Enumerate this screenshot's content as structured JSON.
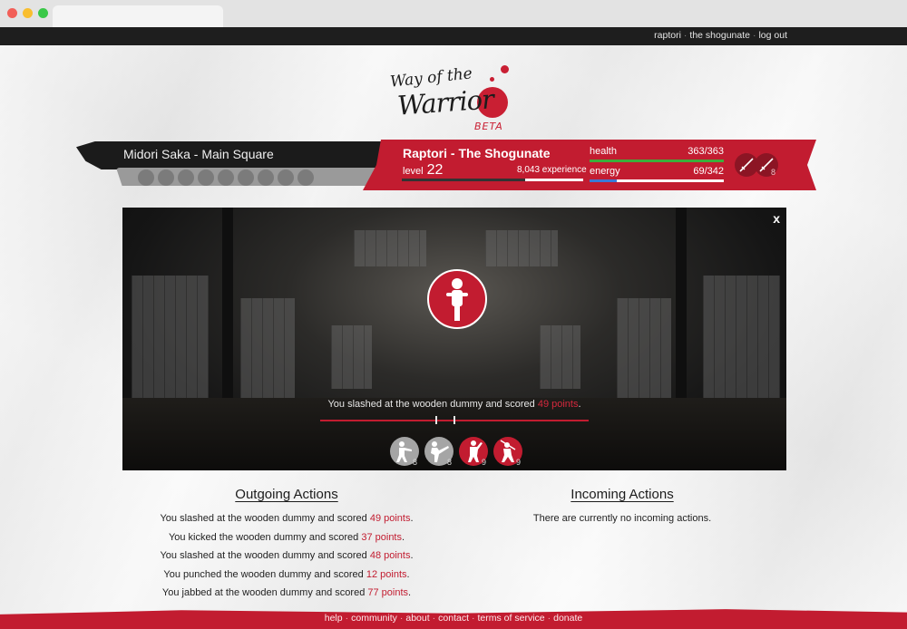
{
  "topnav": {
    "user": "raptori",
    "clan": "the shogunate",
    "logout": "log out"
  },
  "logo": {
    "line1": "Way of the",
    "line2": "Warrior",
    "beta": "BETA"
  },
  "location": "Midori Saka - Main Square",
  "character": {
    "name": "Raptori - The Shogunate",
    "level_label": "level",
    "level": "22",
    "experience": "8,043 experience",
    "experience_progress": 0.68,
    "health_label": "health",
    "health": "363/363",
    "health_fraction": 1.0,
    "energy_label": "energy",
    "energy": "69/342",
    "energy_fraction": 0.2,
    "weapon_count": "8"
  },
  "scene": {
    "close": "x",
    "message_prefix": "You slashed at the wooden dummy and scored",
    "message_points": "49 points",
    "message_suffix": ".",
    "actions": [
      {
        "name": "punch",
        "count": "8",
        "style": "gray"
      },
      {
        "name": "kick",
        "count": "8",
        "style": "gray"
      },
      {
        "name": "jab",
        "count": "9",
        "style": "red"
      },
      {
        "name": "slash",
        "count": "9",
        "style": "red"
      }
    ]
  },
  "outgoing": {
    "title": "Outgoing Actions",
    "items": [
      {
        "text": "You slashed at the wooden dummy and scored",
        "points": "49 points"
      },
      {
        "text": "You kicked the wooden dummy and scored",
        "points": "37 points"
      },
      {
        "text": "You slashed at the wooden dummy and scored",
        "points": "48 points"
      },
      {
        "text": "You punched the wooden dummy and scored",
        "points": "12 points"
      },
      {
        "text": "You jabbed at the wooden dummy and scored",
        "points": "77 points"
      }
    ]
  },
  "incoming": {
    "title": "Incoming Actions",
    "empty": "There are currently no incoming actions."
  },
  "footer": {
    "help": "help",
    "community": "community",
    "about": "about",
    "contact": "contact",
    "terms": "terms of service",
    "donate": "donate"
  },
  "colors": {
    "accent_red": "#c21c30",
    "dark": "#1b1b1b",
    "health_bar": "#3cae3a",
    "energy_bar": "#3a7ad6"
  }
}
